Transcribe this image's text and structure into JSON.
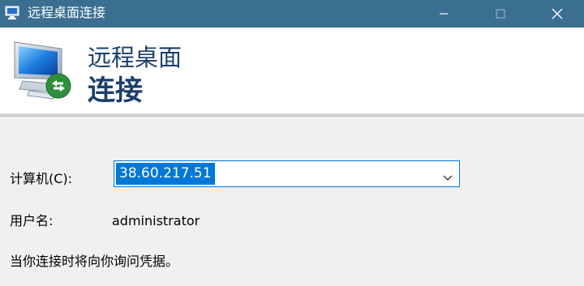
{
  "window": {
    "title": "远程桌面连接",
    "controls": [
      "minimize",
      "maximize",
      "close"
    ]
  },
  "header": {
    "line1": "远程桌面",
    "line2": "连接",
    "icon": "remote-desktop-icon"
  },
  "form": {
    "computer_label": "计算机(C):",
    "computer_value": "38.60.217.51",
    "user_label": "用户名:",
    "user_value": "administrator",
    "credentials_note": "当你连接时将向你询问凭据。"
  },
  "colors": {
    "titlebar": "#3b6f92",
    "header_bg": "#ffffff",
    "body_bg": "#f0f0f0",
    "selection": "#0078d7",
    "header_text": "#1b3f6b"
  }
}
